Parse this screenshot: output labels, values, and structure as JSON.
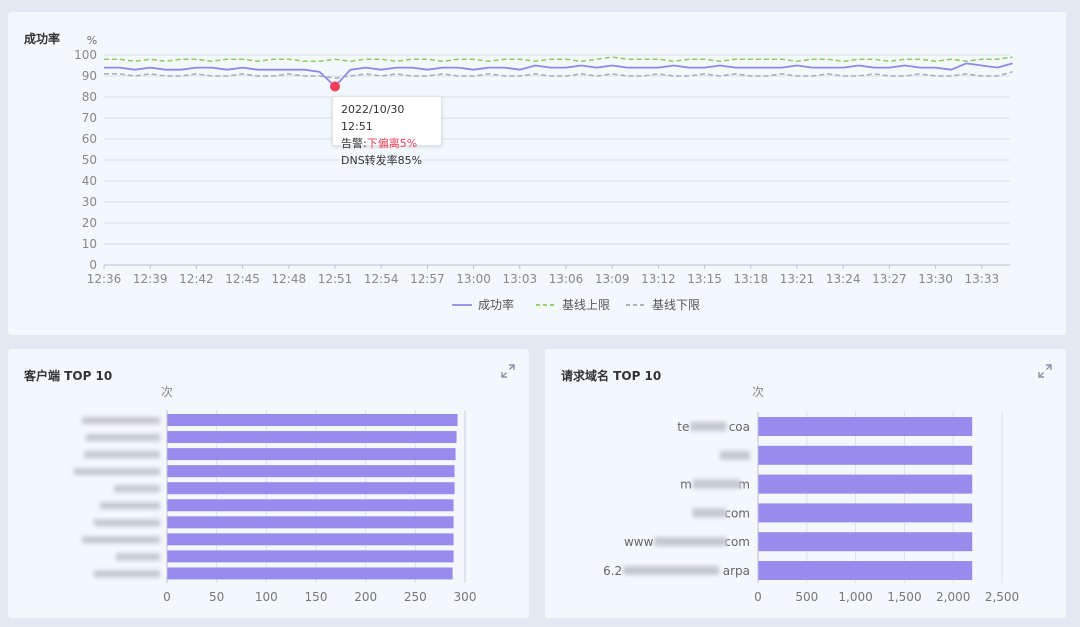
{
  "top_panel": {
    "title": "成功率",
    "tooltip": {
      "date": "2022/10/30",
      "time": "12:51",
      "alert_label": "告警:",
      "alert_value": "下偏离5%",
      "metric_text": "DNS转发率85%"
    }
  },
  "left_panel": {
    "title": "客户端 TOP 10"
  },
  "right_panel": {
    "title": "请求域名 TOP 10"
  },
  "colors": {
    "success": "#8f87e8",
    "upper": "#8ccc5a",
    "lower": "#a6abb8",
    "bar": "#978ced",
    "alert_dot": "#f0405a",
    "alert_text": "#f0405a"
  },
  "chart_data": [
    {
      "type": "line",
      "ylabel": "%",
      "ylim": [
        0,
        100
      ],
      "yticks": [
        0,
        10,
        20,
        30,
        40,
        50,
        60,
        70,
        80,
        90,
        100
      ],
      "x": [
        "12:36",
        "12:37",
        "12:38",
        "12:39",
        "12:40",
        "12:41",
        "12:42",
        "12:43",
        "12:44",
        "12:45",
        "12:46",
        "12:47",
        "12:48",
        "12:49",
        "12:50",
        "12:51",
        "12:52",
        "12:53",
        "12:54",
        "12:55",
        "12:56",
        "12:57",
        "12:58",
        "12:59",
        "13:00",
        "13:01",
        "13:02",
        "13:03",
        "13:04",
        "13:05",
        "13:06",
        "13:07",
        "13:08",
        "13:09",
        "13:10",
        "13:11",
        "13:12",
        "13:13",
        "13:14",
        "13:15",
        "13:16",
        "13:17",
        "13:18",
        "13:19",
        "13:20",
        "13:21",
        "13:22",
        "13:23",
        "13:24",
        "13:25",
        "13:26",
        "13:27",
        "13:28",
        "13:29",
        "13:30",
        "13:31",
        "13:32",
        "13:33",
        "13:34",
        "13:35"
      ],
      "xticks": [
        "12:36",
        "12:39",
        "12:42",
        "12:45",
        "12:48",
        "12:51",
        "12:54",
        "12:57",
        "13:00",
        "13:03",
        "13:06",
        "13:09",
        "13:12",
        "13:15",
        "13:18",
        "13:21",
        "13:24",
        "13:27",
        "13:30",
        "13:33"
      ],
      "series": [
        {
          "name": "成功率",
          "style": "solid",
          "values": [
            94,
            94,
            93,
            94,
            93,
            93,
            94,
            94,
            93,
            94,
            93,
            93,
            93,
            93,
            92,
            85,
            93,
            94,
            93,
            94,
            94,
            93,
            94,
            94,
            93,
            94,
            94,
            93,
            95,
            94,
            94,
            95,
            94,
            95,
            94,
            94,
            94,
            95,
            94,
            94,
            95,
            94,
            94,
            94,
            94,
            95,
            94,
            94,
            94,
            95,
            94,
            94,
            95,
            94,
            94,
            93,
            96,
            95,
            94,
            96
          ]
        },
        {
          "name": "基线上限",
          "style": "dashed",
          "values": [
            98,
            98,
            97,
            98,
            97,
            98,
            98,
            97,
            98,
            98,
            97,
            98,
            98,
            97,
            97,
            98,
            97,
            98,
            98,
            97,
            98,
            98,
            97,
            98,
            98,
            97,
            98,
            98,
            97,
            98,
            98,
            97,
            98,
            99,
            98,
            98,
            98,
            97,
            98,
            98,
            97,
            98,
            98,
            98,
            98,
            97,
            98,
            98,
            97,
            98,
            98,
            97,
            98,
            98,
            97,
            98,
            97,
            98,
            98,
            99
          ]
        },
        {
          "name": "基线下限",
          "style": "dashed",
          "values": [
            91,
            91,
            90,
            91,
            90,
            90,
            91,
            90,
            90,
            91,
            90,
            90,
            91,
            90,
            90,
            89,
            90,
            91,
            90,
            91,
            90,
            90,
            91,
            90,
            90,
            91,
            90,
            90,
            91,
            90,
            90,
            91,
            90,
            91,
            90,
            90,
            91,
            90,
            90,
            91,
            90,
            91,
            90,
            90,
            91,
            90,
            90,
            91,
            90,
            90,
            91,
            90,
            90,
            91,
            90,
            90,
            91,
            90,
            90,
            92
          ]
        }
      ],
      "alert_point": {
        "x": "12:51",
        "y": 85
      }
    },
    {
      "type": "bar",
      "orientation": "horizontal",
      "ylabel": "次",
      "xlim": [
        0,
        300
      ],
      "xticks": [
        0,
        50,
        100,
        150,
        200,
        250,
        300
      ],
      "categories": [
        "",
        "",
        "",
        "",
        "",
        "",
        "",
        "",
        "",
        ""
      ],
      "values": [
        292,
        291,
        290,
        289,
        289,
        288,
        288,
        288,
        288,
        287
      ]
    },
    {
      "type": "bar",
      "orientation": "horizontal",
      "ylabel": "次",
      "xlim": [
        0,
        2500
      ],
      "xticks": [
        "0",
        "500",
        "1,000",
        "1,500",
        "2,000",
        "2,500"
      ],
      "xtick_values": [
        0,
        500,
        1000,
        1500,
        2000,
        2500
      ],
      "categories": [
        {
          "pre": "te",
          "post": "coa"
        },
        {
          "pre": "",
          "post": ""
        },
        {
          "pre": "m",
          "post": "m"
        },
        {
          "pre": "",
          "post": "com"
        },
        {
          "pre": "www",
          "post": "com"
        },
        {
          "pre": "6.2",
          "post": "arpa"
        }
      ],
      "values": [
        2190,
        2190,
        2190,
        2190,
        2190,
        2190
      ]
    }
  ]
}
